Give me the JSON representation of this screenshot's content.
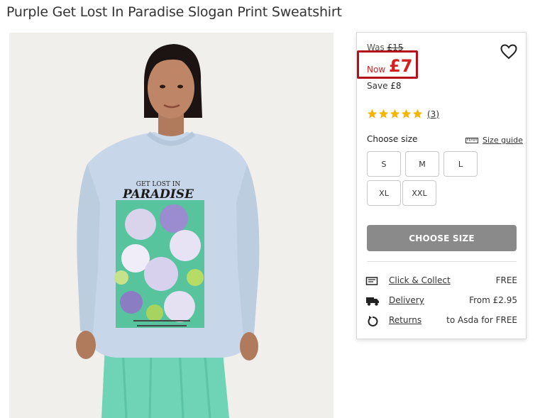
{
  "product": {
    "title": "Purple Get Lost In Paradise Slogan Print Sweatshirt"
  },
  "photo": {
    "print_line1": "GET LOST IN",
    "print_line2": "PARADISE"
  },
  "price": {
    "was_label": "Was",
    "was_value": "£15",
    "now_label": "Now",
    "now_value": "£7",
    "save_label": "Save",
    "save_value": "£8",
    "highlight_color": "#b3121a",
    "price_color": "#d1201f"
  },
  "rating": {
    "stars": 5,
    "reviews": "(3)",
    "star_color": "#f5b400"
  },
  "size": {
    "label": "Choose size",
    "guide": "Size guide",
    "options": [
      "S",
      "M",
      "L",
      "XL",
      "XXL"
    ]
  },
  "cta": {
    "label": "CHOOSE SIZE"
  },
  "delivery": [
    {
      "icon": "click-collect-icon",
      "label": "Click & Collect",
      "value": "FREE"
    },
    {
      "icon": "truck-icon",
      "label": "Delivery",
      "value": "From £2.95"
    },
    {
      "icon": "returns-icon",
      "label": "Returns",
      "value": "to Asda for FREE"
    }
  ]
}
